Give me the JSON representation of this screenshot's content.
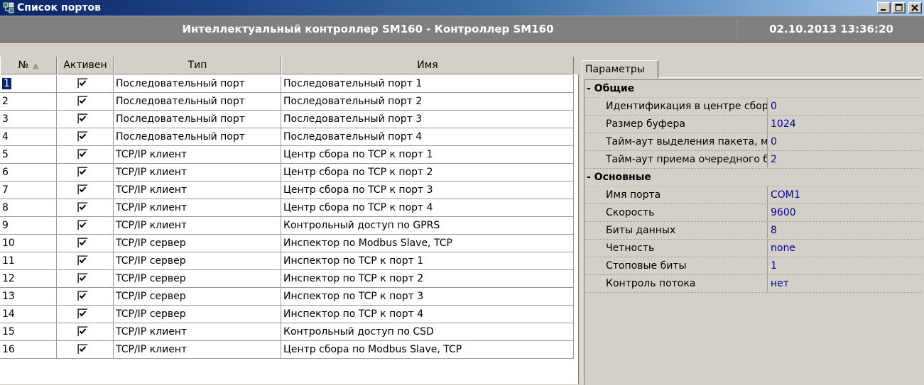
{
  "window": {
    "title": "Список портов",
    "icon": "ports-icon"
  },
  "header": {
    "title": "Интеллектуальный контроллер SM160 - Контроллер SM160",
    "datetime": "02.10.2013 13:36:20"
  },
  "grid": {
    "columns": [
      "№",
      "Активен",
      "Тип",
      "Имя"
    ],
    "sort_indicator": "▲",
    "focused_row": 0,
    "rows": [
      {
        "num": "1",
        "active": true,
        "type": "Последовательный порт",
        "name": "Последовательный порт 1"
      },
      {
        "num": "2",
        "active": true,
        "type": "Последовательный порт",
        "name": "Последовательный порт 2"
      },
      {
        "num": "3",
        "active": true,
        "type": "Последовательный порт",
        "name": "Последовательный порт 3"
      },
      {
        "num": "4",
        "active": true,
        "type": "Последовательный порт",
        "name": "Последовательный порт 4"
      },
      {
        "num": "5",
        "active": true,
        "type": "TCP/IP клиент",
        "name": "Центр сбора по TCP к порт 1"
      },
      {
        "num": "6",
        "active": true,
        "type": "TCP/IP клиент",
        "name": "Центр сбора по TCP к порт 2"
      },
      {
        "num": "7",
        "active": true,
        "type": "TCP/IP клиент",
        "name": "Центр сбора по TCP к порт 3"
      },
      {
        "num": "8",
        "active": true,
        "type": "TCP/IP клиент",
        "name": "Центр сбора по TCP к порт 4"
      },
      {
        "num": "9",
        "active": true,
        "type": "TCP/IP клиент",
        "name": "Контрольный доступ по GPRS"
      },
      {
        "num": "10",
        "active": true,
        "type": "TCP/IP сервер",
        "name": "Инспектор по Modbus Slave, TCP"
      },
      {
        "num": "11",
        "active": true,
        "type": "TCP/IP сервер",
        "name": "Инспектор по TCP к порт 1"
      },
      {
        "num": "12",
        "active": true,
        "type": "TCP/IP сервер",
        "name": "Инспектор по TCP к порт 2"
      },
      {
        "num": "13",
        "active": true,
        "type": "TCP/IP сервер",
        "name": "Инспектор по TCP к порт 3"
      },
      {
        "num": "14",
        "active": true,
        "type": "TCP/IP сервер",
        "name": "Инспектор по TCP к порт 4"
      },
      {
        "num": "15",
        "active": true,
        "type": "TCP/IP клиент",
        "name": "Контрольный доступ по CSD"
      },
      {
        "num": "16",
        "active": true,
        "type": "TCP/IP клиент",
        "name": "Центр сбора по Modbus Slave, TCP"
      }
    ]
  },
  "properties": {
    "tab_label": "Параметры",
    "rows": [
      {
        "kind": "category",
        "label": "- Общие"
      },
      {
        "kind": "prop",
        "name": "Идентификация в центре сбор",
        "value": "0"
      },
      {
        "kind": "prop",
        "name": "Размер буфера",
        "value": "1024"
      },
      {
        "kind": "prop",
        "name": "Тайм-аут выделения пакета, м",
        "value": "0"
      },
      {
        "kind": "prop",
        "name": "Тайм-аут приема очередного б",
        "value": "2"
      },
      {
        "kind": "category",
        "label": "- Основные"
      },
      {
        "kind": "prop",
        "name": "Имя порта",
        "value": "COM1"
      },
      {
        "kind": "prop",
        "name": "Скорость",
        "value": "9600"
      },
      {
        "kind": "prop",
        "name": "Биты данных",
        "value": "8"
      },
      {
        "kind": "prop",
        "name": "Четность",
        "value": "none"
      },
      {
        "kind": "prop",
        "name": "Стоповые биты",
        "value": "1"
      },
      {
        "kind": "prop",
        "name": "Контроль потока",
        "value": "нет"
      }
    ]
  },
  "colors": {
    "title_gradient_start": "#0a246a",
    "title_gradient_end": "#a6caf0",
    "header_bg": "#808080",
    "value_text": "#0000a0",
    "selection": "#0a246a"
  }
}
